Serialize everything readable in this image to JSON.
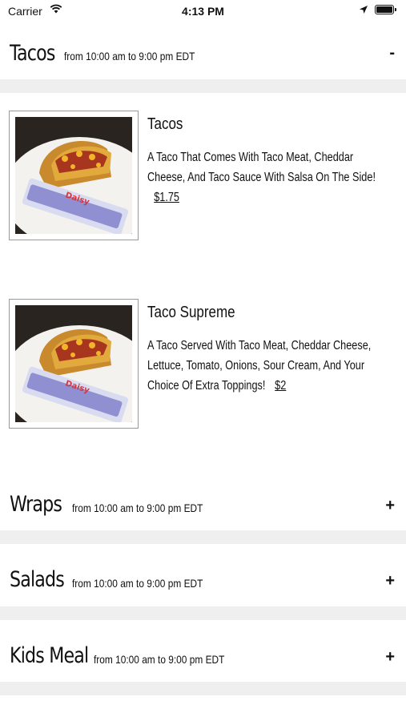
{
  "status_bar": {
    "carrier": "Carrier",
    "time": "4:13 PM"
  },
  "sections": [
    {
      "title": "Tacos",
      "hours": "from 10:00 am to 9:00 pm EDT",
      "toggle": "-",
      "expanded": true,
      "items": [
        {
          "name": "Tacos",
          "description": "A Taco That Comes With Taco Meat, Cheddar Cheese, And Taco Sauce With Salsa On The Side!",
          "price": "$1.75"
        },
        {
          "name": "Taco Supreme",
          "description": "A Taco Served With Taco Meat, Cheddar Cheese, Lettuce, Tomato, Onions, Sour Cream, And Your Choice Of Extra Toppings!",
          "price": "$2"
        }
      ]
    },
    {
      "title": "Wraps",
      "hours": "from 10:00 am to 9:00 pm EDT",
      "toggle": "+",
      "expanded": false
    },
    {
      "title": "Salads",
      "hours": "from 10:00 am to 9:00 pm EDT",
      "toggle": "+",
      "expanded": false
    },
    {
      "title": "Kids Meal",
      "hours": "from 10:00 am to 9:00 pm EDT",
      "toggle": "+",
      "expanded": false
    }
  ],
  "food_image": {
    "packet_brand": "Daisy"
  }
}
